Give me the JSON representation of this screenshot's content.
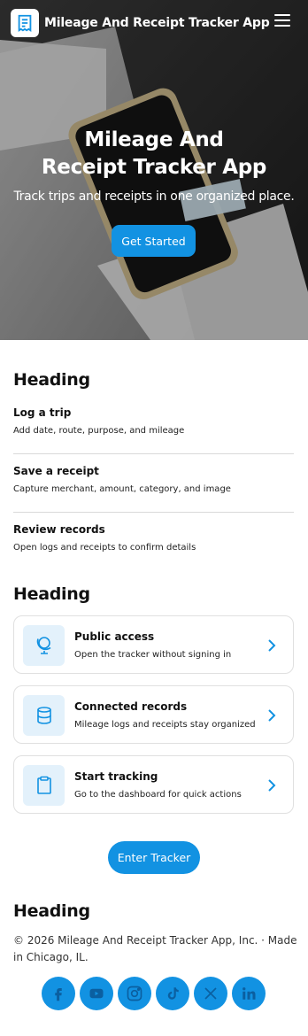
{
  "header": {
    "app_name": "Mileage And Receipt Tracker App",
    "logo_icon": "receipt-icon",
    "menu_icon": "hamburger-menu-icon"
  },
  "hero": {
    "title_line1": "Mileage And",
    "title_line2": "Receipt Tracker App",
    "subtitle": "Track trips and receipts in one organized place.",
    "cta_label": "Get Started"
  },
  "steps_section": {
    "heading": "Heading",
    "items": [
      {
        "title": "Log a trip",
        "desc": "Add date, route, purpose, and mileage"
      },
      {
        "title": "Save a receipt",
        "desc": "Capture merchant, amount, category, and image"
      },
      {
        "title": "Review records",
        "desc": "Open logs and receipts to confirm details"
      }
    ]
  },
  "cards_section": {
    "heading": "Heading",
    "cards": [
      {
        "title": "Public access",
        "desc": "Open the tracker without signing in",
        "icon": "globe-icon"
      },
      {
        "title": "Connected records",
        "desc": "Mileage logs and receipts stay organized",
        "icon": "database-icon"
      },
      {
        "title": "Start tracking",
        "desc": "Go to the dashboard for quick actions",
        "icon": "clipboard-icon"
      }
    ],
    "enter_label": "Enter Tracker"
  },
  "footer": {
    "heading": "Heading",
    "copyright": "© 2026 Mileage And Receipt Tracker App, Inc. · Made in Chicago, IL.",
    "socials": [
      "facebook-icon",
      "youtube-icon",
      "instagram-icon",
      "tiktok-icon",
      "x-icon",
      "linkedin-icon"
    ]
  },
  "colors": {
    "accent": "#1292e2",
    "icon_bg": "#e3f1fb"
  }
}
